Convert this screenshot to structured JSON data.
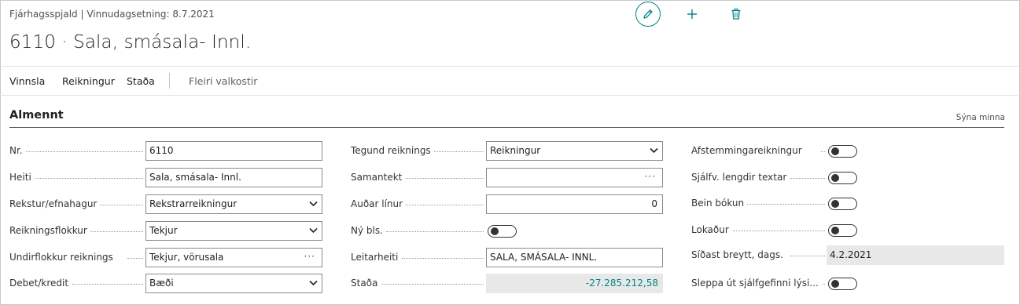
{
  "header": {
    "caption": "Fjárhagsspjald | Vinnudagsetning: 8.7.2021",
    "title": "6110 · Sala, smásala- Innl."
  },
  "actions": {
    "edit_icon": "pencil-icon",
    "add_icon": "plus-icon",
    "delete_icon": "trash-icon",
    "accent": "#008489"
  },
  "menu": {
    "items": [
      "Vinnsla",
      "Reikningur",
      "Staða"
    ],
    "more": "Fleiri valkostir"
  },
  "section": {
    "title": "Almennt",
    "toggle_label": "Sýna minna"
  },
  "col1": [
    {
      "label": "Nr.",
      "value": "6110",
      "kind": "text"
    },
    {
      "label": "Heiti",
      "value": "Sala, smásala- Innl.",
      "kind": "text"
    },
    {
      "label": "Rekstur/efnahagur",
      "value": "Rekstrarreikningur",
      "kind": "select"
    },
    {
      "label": "Reikningsflokkur",
      "value": "Tekjur",
      "kind": "select"
    },
    {
      "label": "Undirflokkur reiknings",
      "value": "Tekjur, vörusala",
      "kind": "lookup"
    },
    {
      "label": "Debet/kredit",
      "value": "Bæði",
      "kind": "select"
    }
  ],
  "col2": [
    {
      "label": "Tegund reiknings",
      "value": "Reikningur",
      "kind": "select"
    },
    {
      "label": "Samantekt",
      "value": "",
      "kind": "lookup"
    },
    {
      "label": "Auðar línur",
      "value": "0",
      "kind": "number"
    },
    {
      "label": "Ný bls.",
      "value": "",
      "kind": "toggle"
    },
    {
      "label": "Leitarheiti",
      "value": "SALA, SMÁSALA- INNL.",
      "kind": "text"
    },
    {
      "label": "Staða",
      "value": "-27.285.212,58",
      "kind": "readonly-amount"
    }
  ],
  "col3": [
    {
      "label": "Afstemmingareikningur",
      "kind": "toggle"
    },
    {
      "label": "Sjálfv. lengdir textar",
      "kind": "toggle"
    },
    {
      "label": "Bein bókun",
      "kind": "toggle"
    },
    {
      "label": "Lokaður",
      "kind": "toggle"
    },
    {
      "label": "Síðast breytt, dags.",
      "value": "4.2.2021",
      "kind": "readonly"
    },
    {
      "label": "Sleppa út sjálfgefinni lýsi...",
      "kind": "toggle"
    }
  ]
}
